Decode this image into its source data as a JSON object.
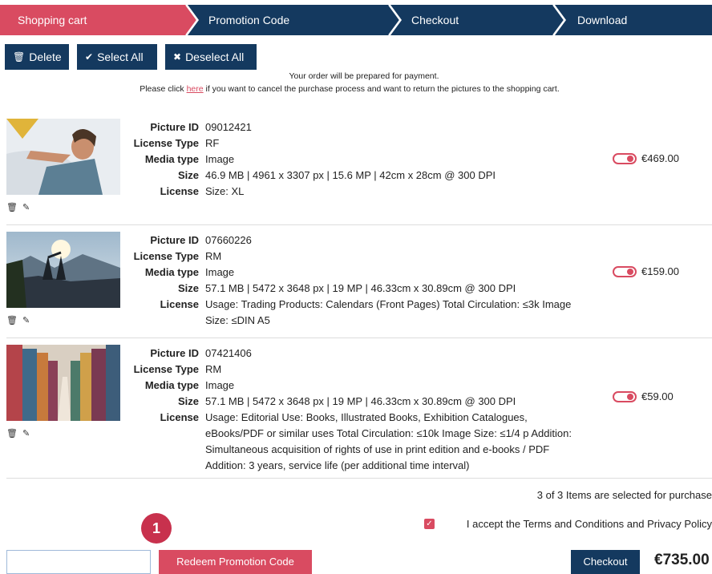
{
  "steps": [
    "Shopping cart",
    "Promotion Code",
    "Checkout",
    "Download"
  ],
  "colors": {
    "active_step": "#d94b61",
    "step_bg": "#14395f",
    "accent": "#d94b61"
  },
  "toolbar": {
    "delete_label": "Delete",
    "select_all_label": "Select All",
    "deselect_all_label": "Deselect All"
  },
  "notice": {
    "line1": "Your order will be prepared for payment.",
    "line2_pre": "Please click ",
    "line2_link": "here",
    "line2_post": " if you want to cancel the purchase process and want to return the pictures to the shopping cart."
  },
  "labels": {
    "picture_id": "Picture ID",
    "license_type": "License Type",
    "media_type": "Media type",
    "size": "Size",
    "license": "License"
  },
  "items": [
    {
      "picture_id": "09012421",
      "license_type": "RF",
      "media_type": "Image",
      "size": "46.9 MB | 4961 x 3307 px | 15.6 MP | 42cm x 28cm @ 300 DPI",
      "license": [
        "Size: XL"
      ],
      "price": "€469.00",
      "selected": true
    },
    {
      "picture_id": "07660226",
      "license_type": "RM",
      "media_type": "Image",
      "size": "57.1 MB | 5472 x 3648 px | 19 MP | 46.33cm x 30.89cm @ 300 DPI",
      "license": [
        "Usage: Trading Products: Calendars (Front Pages) Total Circulation: ≤3k Image",
        "Size: ≤DIN A5"
      ],
      "price": "€159.00",
      "selected": true
    },
    {
      "picture_id": "07421406",
      "license_type": "RM",
      "media_type": "Image",
      "size": "57.1 MB | 5472 x 3648 px | 19 MP | 46.33cm x 30.89cm @ 300 DPI",
      "license": [
        "Usage: Editorial Use: Books, Illustrated Books, Exhibition Catalogues,",
        "eBooks/PDF or similar uses Total Circulation: ≤10k Image Size: ≤1/4 p Addition:",
        "Simultaneous acquisition of rights of use in print edition and e-books / PDF",
        "Addition: 3 years, service life (per additional time interval)"
      ],
      "price": "€59.00",
      "selected": true
    }
  ],
  "footer": {
    "selection_info": "3 of 3 Items are selected for purchase",
    "badge": "1",
    "terms": "I accept the Terms and Conditions and Privacy Policy",
    "promo_placeholder": "",
    "redeem_label": "Redeem Promotion Code",
    "checkout_label": "Checkout",
    "total": "€735.00"
  }
}
